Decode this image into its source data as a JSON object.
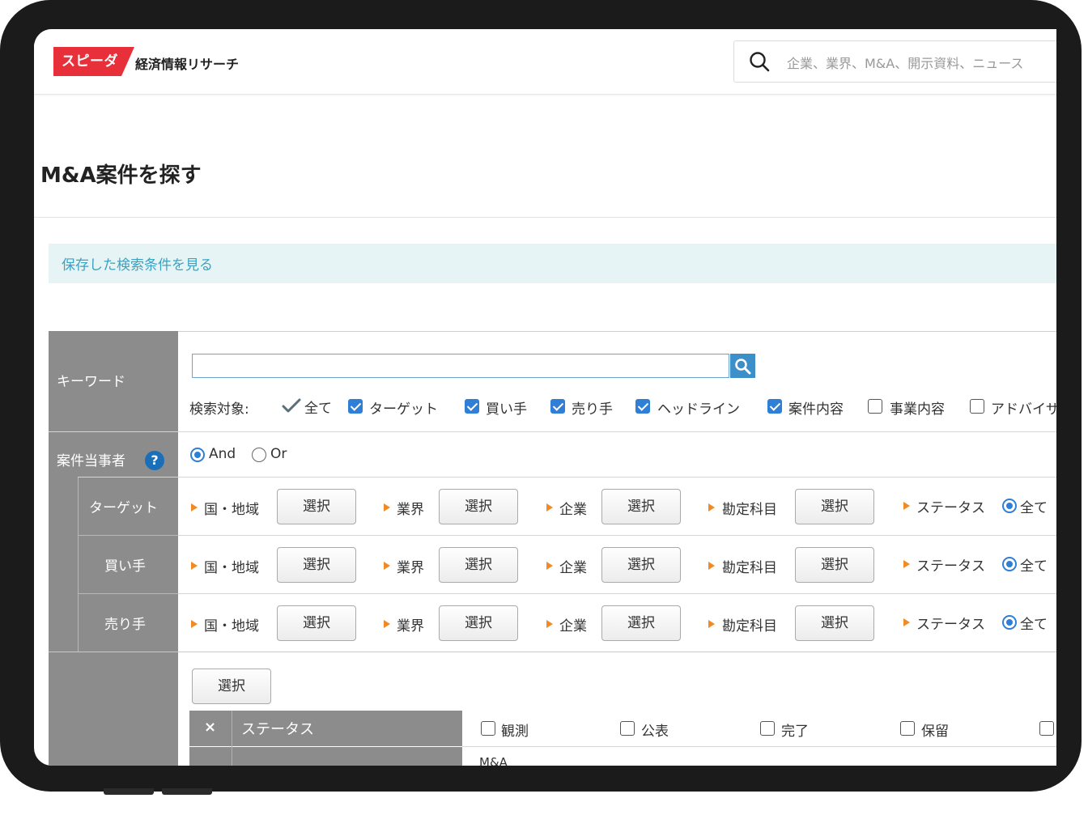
{
  "header": {
    "logo_mark": "スピーダ",
    "logo_text": "経済情報リサーチ",
    "search_placeholder": "企業、業界、M&A、開示資料、ニュース"
  },
  "page": {
    "title": "M&A案件を探す",
    "saved_link": "保存した検索条件を見る"
  },
  "keyword": {
    "label": "キーワード",
    "value": "",
    "target_label": "検索対象:",
    "all_label": "全て",
    "targets": [
      {
        "label": "ターゲット",
        "checked": true
      },
      {
        "label": "買い手",
        "checked": true
      },
      {
        "label": "売り手",
        "checked": true
      },
      {
        "label": "ヘッドライン",
        "checked": true
      },
      {
        "label": "案件内容",
        "checked": true
      },
      {
        "label": "事業内容",
        "checked": false
      },
      {
        "label": "アドバイザー",
        "checked": false
      }
    ]
  },
  "parties": {
    "label": "案件当事者",
    "help": "?",
    "and_label": "And",
    "or_label": "Or",
    "selected": "And",
    "rows": [
      {
        "label": "ターゲット"
      },
      {
        "label": "買い手"
      },
      {
        "label": "売り手"
      }
    ],
    "fields": [
      "国・地域",
      "業界",
      "企業",
      "勘定科目"
    ],
    "select_label": "選択",
    "status_label": "ステータス",
    "status_value": "全て"
  },
  "status_section": {
    "select_label": "選択",
    "close_glyph": "×",
    "header": "ステータス",
    "options": [
      "観測",
      "公表",
      "完了",
      "保留"
    ],
    "next_row_partial": "M&A"
  }
}
